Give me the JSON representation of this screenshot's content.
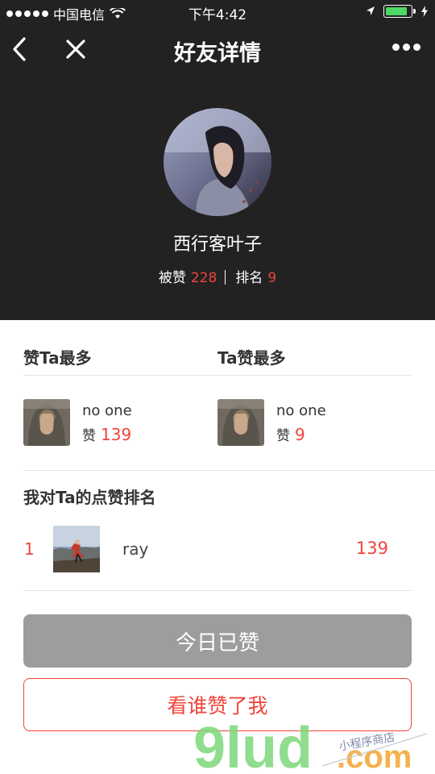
{
  "status_bar": {
    "carrier": "中国电信",
    "time": "下午4:42"
  },
  "nav": {
    "title": "好友详情",
    "back_icon": "chevron-left-icon",
    "close_icon": "close-icon",
    "more_icon": "more-dots-icon"
  },
  "profile": {
    "name": "西行客叶子",
    "liked_label": "被赞",
    "liked_count": "228",
    "rank_label": "排名",
    "rank_value": "9"
  },
  "top_likers": {
    "heading": "赞Ta最多",
    "name": "no one",
    "likes_label": "赞",
    "likes_count": "139"
  },
  "top_liked": {
    "heading": "Ta赞最多",
    "name": "no one",
    "likes_label": "赞",
    "likes_count": "9"
  },
  "my_ranking": {
    "heading": "我对Ta的点赞排名",
    "rows": [
      {
        "rank": "1",
        "name": "ray",
        "count": "139"
      }
    ]
  },
  "buttons": {
    "liked_today": "今日已赞",
    "who_liked_me": "看谁赞了我"
  },
  "watermark": {
    "brand": "9lud",
    "suffix": ".com",
    "tagline": "小程序商店"
  },
  "colors": {
    "accent": "#f0443c",
    "header_bg": "#222222",
    "disabled_button": "#9d9d9d",
    "watermark_green": "#7dd87a",
    "watermark_orange": "#f4a93a"
  }
}
